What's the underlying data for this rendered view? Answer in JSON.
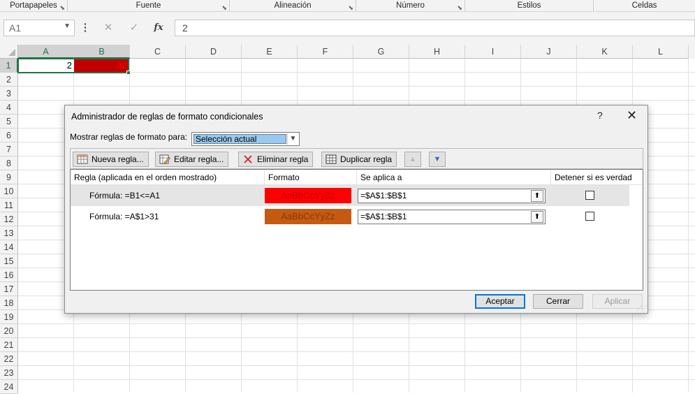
{
  "ribbon_groups": [
    {
      "label": "Portapapeles",
      "launcher": true
    },
    {
      "label": "Fuente",
      "launcher": true
    },
    {
      "label": "Alineación",
      "launcher": true
    },
    {
      "label": "Número",
      "launcher": true
    },
    {
      "label": "Estilos",
      "launcher": false
    },
    {
      "label": "Celdas",
      "launcher": false
    }
  ],
  "formula_bar": {
    "name_box": "A1",
    "more_icon": "⋮",
    "cancel_icon": "✕",
    "enter_icon": "✓",
    "fx_label": "fx",
    "formula": "2"
  },
  "columns": [
    "A",
    "B",
    "C",
    "D",
    "E",
    "F",
    "G",
    "H",
    "I",
    "J",
    "K",
    "L"
  ],
  "selected_columns": [
    "A",
    "B"
  ],
  "rows": [
    "1",
    "2",
    "3",
    "4",
    "5",
    "6",
    "7",
    "8",
    "9",
    "10",
    "11",
    "12",
    "13",
    "14",
    "15",
    "16",
    "17",
    "18",
    "19",
    "20",
    "21",
    "22",
    "23",
    "24"
  ],
  "cells": {
    "A1": "2",
    "B1": "32"
  },
  "colors": {
    "b1_fill": "#c00000",
    "b1_font": "#ff0000",
    "rule1_fill": "#ff0000",
    "rule1_font": "#c00000",
    "rule2_fill": "#c55a11",
    "rule2_font": "#833c0b",
    "accent": "#217346"
  },
  "dialog": {
    "title": "Administrador de reglas de formato condicionales",
    "help_icon": "?",
    "close_icon": "✕",
    "show_label": "Mostrar reglas de formato para:",
    "show_value": "Selección actual",
    "toolbar": {
      "new_rule": "Nueva regla...",
      "edit_rule": "Editar regla...",
      "delete_rule": "Eliminar regla",
      "duplicate_rule": "Duplicar regla"
    },
    "headers": {
      "rule": "Regla (aplicada en el orden mostrado)",
      "format": "Formato",
      "applies": "Se aplica a",
      "stop": "Detener si es verdad"
    },
    "rules": [
      {
        "label": "Fórmula: =B1<=A1",
        "preview": "AaBbCcYyZz",
        "applies_to": "=$A$1:$B$1",
        "stop_if_true": false
      },
      {
        "label": "Fórmula: =A$1>31",
        "preview": "AaBbCcYyZz",
        "applies_to": "=$A$1:$B$1",
        "stop_if_true": false
      }
    ],
    "buttons": {
      "ok": "Aceptar",
      "cancel": "Cerrar",
      "apply": "Aplicar"
    }
  }
}
